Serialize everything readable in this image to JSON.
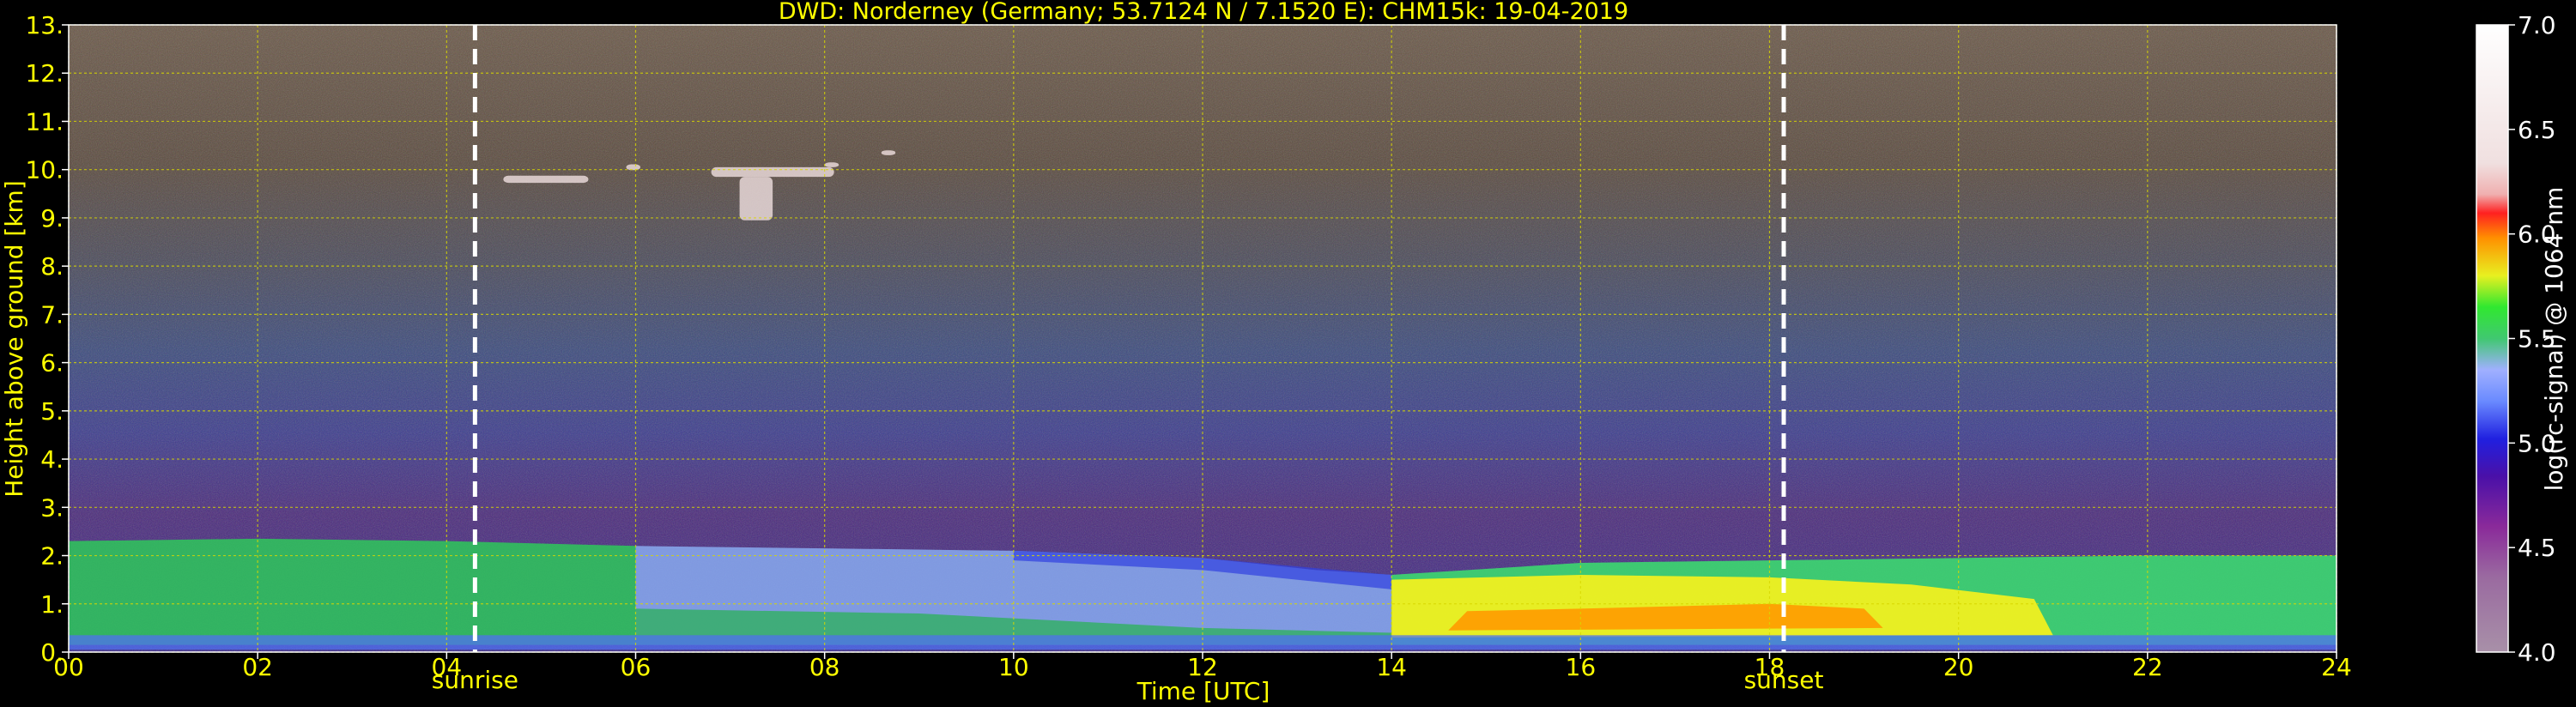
{
  "chart_data": {
    "type": "heatmap",
    "title": "DWD: Norderney (Germany; 53.7124 N / 7.1520 E):    CHM15k: 19-04-2019",
    "xlabel": "Time [UTC]",
    "ylabel": "Height above ground [km]",
    "xlim": [
      0,
      24
    ],
    "ylim": [
      0,
      13
    ],
    "x_ticks": [
      "00",
      "02",
      "04",
      "06",
      "08",
      "10",
      "12",
      "14",
      "16",
      "18",
      "20",
      "22",
      "24"
    ],
    "y_ticks": [
      "0.",
      "1.",
      "2.",
      "3.",
      "4.",
      "5.",
      "6.",
      "7.",
      "8.",
      "9.",
      "10.",
      "11.",
      "12.",
      "13."
    ],
    "grid": true,
    "annotations": [
      {
        "label": "sunrise",
        "x": 4.3
      },
      {
        "label": "sunset",
        "x": 18.15
      }
    ],
    "colorbar": {
      "label": "log(rc-signal) @ 1064 nm",
      "range": [
        4.0,
        7.0
      ],
      "ticks": [
        "4.0",
        "4.5",
        "5.0",
        "5.5",
        "6.0",
        "6.5",
        "7.0"
      ]
    },
    "layers": [
      {
        "name": "boundary layer (lower)",
        "x": [
          0,
          14
        ],
        "top_km": [
          2.3,
          2.3,
          2.3,
          2.2,
          2.15,
          2.1,
          2.0,
          1.6
        ],
        "dominant_value": 5.4
      },
      {
        "name": "boundary layer (afternoon)",
        "x": [
          14,
          24
        ],
        "top_km": [
          1.6,
          1.85,
          1.9,
          1.95,
          2.0,
          2.0
        ],
        "dominant_value": 5.7
      },
      {
        "name": "cirrus patches",
        "x": [
          4.5,
          8.6
        ],
        "height_km": [
          9.2,
          10.4
        ],
        "dominant_value": 6.2
      }
    ]
  },
  "colors": {
    "text": "#ffff00",
    "grid": "#d8d800",
    "background": "#000000"
  }
}
